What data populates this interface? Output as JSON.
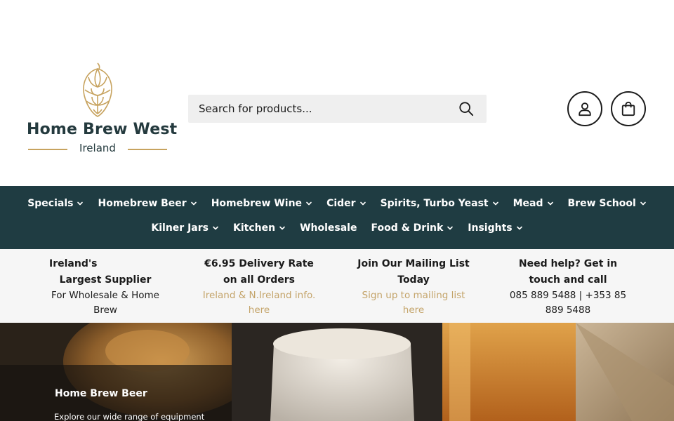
{
  "brand": {
    "name": "Home Brew West",
    "subtitle": "Ireland",
    "gold": "#c7a35f",
    "dark": "#243a3e"
  },
  "search": {
    "placeholder": "Search for products...",
    "icon": "search-icon"
  },
  "header_actions": {
    "account_icon": "user-icon",
    "cart_icon": "shopping-bag-icon"
  },
  "nav": {
    "bg": "#1f3c42",
    "row1": [
      {
        "label": "Specials",
        "has_dropdown": true
      },
      {
        "label": "Homebrew Beer",
        "has_dropdown": true
      },
      {
        "label": "Homebrew Wine",
        "has_dropdown": true
      },
      {
        "label": "Cider",
        "has_dropdown": true
      },
      {
        "label": "Spirits, Turbo Yeast",
        "has_dropdown": true
      },
      {
        "label": "Mead",
        "has_dropdown": true
      },
      {
        "label": "Brew School",
        "has_dropdown": true
      }
    ],
    "row2": [
      {
        "label": "Kilner Jars",
        "has_dropdown": true
      },
      {
        "label": "Kitchen",
        "has_dropdown": true
      },
      {
        "label": "Wholesale",
        "has_dropdown": false
      },
      {
        "label": "Food & Drink",
        "has_dropdown": true
      },
      {
        "label": "Insights",
        "has_dropdown": true
      }
    ]
  },
  "info": {
    "link_color": "#c4a46a",
    "col1": {
      "title_a": "Ireland's",
      "title_b": "Largest Supplier",
      "desc_a": "For Wholesale & Home",
      "desc_b": "Brew"
    },
    "col2": {
      "title_a": "€6.95 Delivery Rate",
      "title_b": "on all Orders",
      "link_a": "Ireland & N.Ireland info.",
      "link_b": "here"
    },
    "col3": {
      "title_a": "Join Our Mailing List",
      "title_b": "Today",
      "link_a": "Sign up to mailing list",
      "link_b": "here"
    },
    "col4": {
      "title_a": "Need help? Get in",
      "title_b": "touch and call",
      "desc_a": "085 889 5488 | +353 85",
      "desc_b": "889 5488"
    }
  },
  "hero": {
    "title": "Home Brew Beer",
    "subtitle": "Explore our wide range of equipment"
  }
}
